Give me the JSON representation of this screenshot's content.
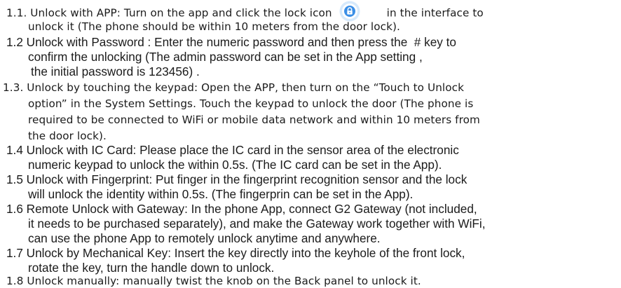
{
  "items": [
    {
      "lines": [
        "1.1. Unlock with APP: Turn on the app and click the lock icon",
        "in the interface to",
        "unlock it (The phone should be within 10 meters from the door lock)."
      ]
    },
    {
      "lines": [
        "1.2 Unlock with Password : Enter the numeric password and then press the  # key to",
        "confirm the unlocking (The admin password can be set in the App setting ,",
        "the initial password is 123456) ."
      ]
    },
    {
      "lines": [
        "1.3. Unlock by touching the keypad: Open the APP, then turn on the “Touch to Unlock",
        "option” in the System Settings. Touch the keypad to unlock the door (The phone is",
        "required to be connected to WiFi or mobile data network and within 10 meters from",
        "the door lock)."
      ]
    },
    {
      "lines": [
        "1.4 Unlock with IC Card: Please place the IC card in the sensor area of the electronic",
        "numeric keypad to unlock the within 0.5s. (The IC card can be set in the App)."
      ]
    },
    {
      "lines": [
        "1.5 Unlock with Fingerprint: Put finger in the fingerprint recognition sensor and the lock",
        "will unlock the identity within 0.5s. (The fingerprin can be set in the App)."
      ]
    },
    {
      "lines": [
        "1.6 Remote Unlock with Gateway: In the phone App, connect G2 Gateway (not included,",
        "it needs to be purchased separately), and make the Gateway work together with WiFi,",
        "can use the phone App to remotely unlock anytime and anywhere."
      ]
    },
    {
      "lines": [
        "1.7 Unlock by Mechanical Key: Insert the key directly into the keyhole of the front lock,",
        "rotate the key, turn the handle down to unlock."
      ]
    },
    {
      "lines": [
        "1.8 Unlock manually: manually twist the knob on the Back panel to unlock it."
      ]
    }
  ],
  "colors": {
    "text": "#1b1b1b",
    "icon_glow": "#d6e9fb",
    "icon_fill": "#3a8ee6"
  },
  "icons": {
    "inline_lock": "lock-icon"
  }
}
